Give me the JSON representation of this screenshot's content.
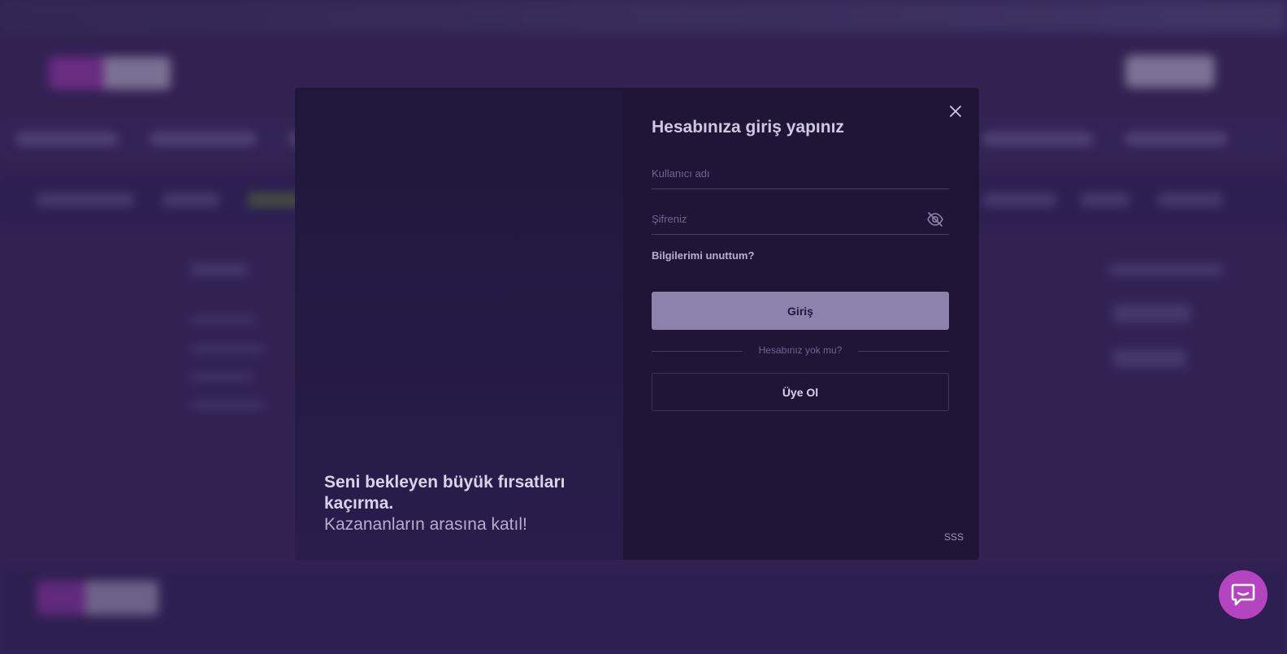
{
  "colors": {
    "accent": "#b444c0",
    "modal_bg": "#201536",
    "login_button": "#8c82ac",
    "title_text": "#cfc8e2"
  },
  "modal": {
    "title": "Hesabınıza giriş yapınız",
    "username": {
      "placeholder": "Kullanıcı adı",
      "value": ""
    },
    "password": {
      "placeholder": "Şifreniz",
      "value": "",
      "toggle_icon": "eye-off-icon"
    },
    "forgot_link": "Bilgilerimi unuttum?",
    "login_button": "Giriş",
    "divider_text": "Hesabınız yok mu?",
    "register_button": "Üye Ol",
    "faq_link": "SSS",
    "close_icon": "close-icon",
    "promo": {
      "title": "Seni bekleyen büyük fırsatları kaçırma.",
      "subtitle": "Kazananların arasına katıl!"
    }
  },
  "chat_widget": {
    "icon": "chat-bubble-icon"
  }
}
